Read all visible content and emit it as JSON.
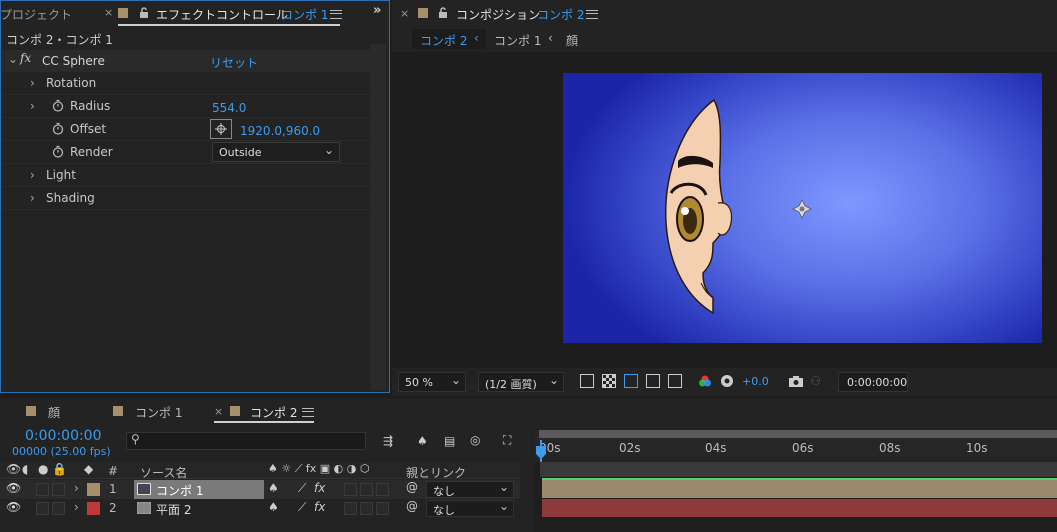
{
  "project_tab": "プロジェクト",
  "effect_panel": {
    "tab_prefix": "エフェクトコントロール",
    "tab_comp": "コンポ 1",
    "breadcrumb": "コンポ 2・コンポ 1",
    "effect_name": "CC Sphere",
    "reset_label": "リセット",
    "props": {
      "rotation": "Rotation",
      "radius": "Radius",
      "radius_value": "554.0",
      "offset": "Offset",
      "offset_value": "1920.0,960.0",
      "render": "Render",
      "render_value": "Outside",
      "light": "Light",
      "shading": "Shading"
    }
  },
  "comp_panel": {
    "tab_prefix": "コンポジション",
    "tab_comp": "コンポ 2",
    "crumbs": [
      "コンポ 2",
      "コンポ 1",
      "顔"
    ],
    "zoom": "50 %",
    "resolution": "(1/2 画質)",
    "exposure": "+0.0",
    "timecode": "0:00:00:00"
  },
  "timeline": {
    "tabs": [
      "顔",
      "コンポ 1",
      "コンポ 2"
    ],
    "timecode": "0:00:00:00",
    "frames": "00000 (25.00 fps)",
    "search_placeholder": "",
    "col_num": "#",
    "col_source": "ソース名",
    "col_parent": "親とリンク",
    "ruler": [
      "00s",
      "02s",
      "04s",
      "06s",
      "08s",
      "10s"
    ],
    "layers": [
      {
        "num": "1",
        "name": "コンポ 1",
        "parent": "なし",
        "color": "#a88f6c"
      },
      {
        "num": "2",
        "name": "平面 2",
        "parent": "なし",
        "color": "#c0383a"
      }
    ]
  },
  "colors": {
    "accent": "#3d9bf0",
    "comp_bg_center": "#7f98ff",
    "comp_bg_edge": "#1c25a8"
  }
}
